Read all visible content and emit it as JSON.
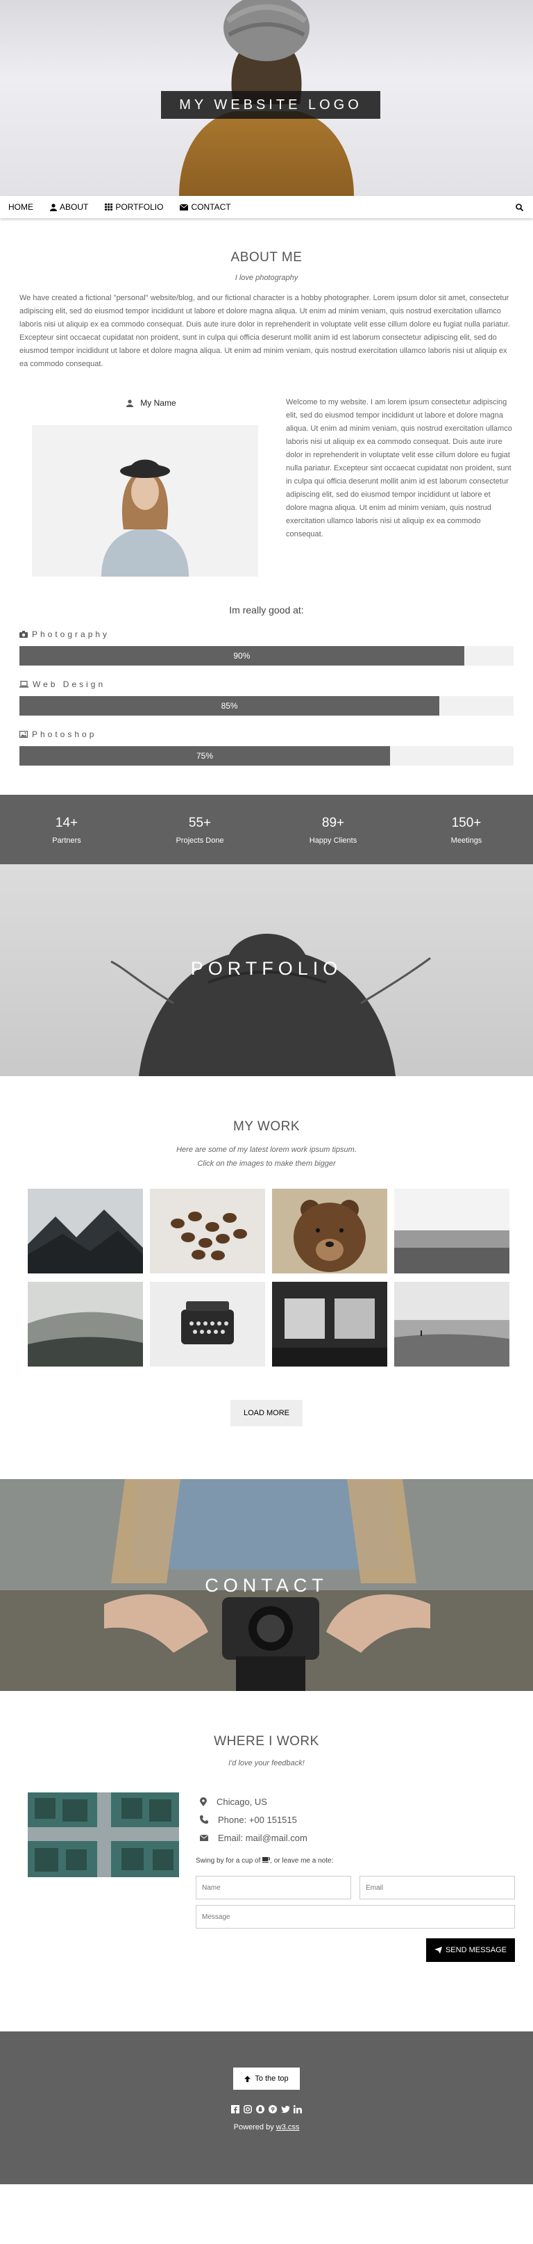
{
  "header": {
    "logo_text": "MY WEBSITE LOGO"
  },
  "nav": {
    "home": "HOME",
    "about": "ABOUT",
    "portfolio": "PORTFOLIO",
    "contact": "CONTACT",
    "search_icon": "search-icon"
  },
  "about": {
    "title": "ABOUT ME",
    "subtitle": "I love photography",
    "intro": "We have created a fictional \"personal\" website/blog, and our fictional character is a hobby photographer. Lorem ipsum dolor sit amet, consectetur adipiscing elit, sed do eiusmod tempor incididunt ut labore et dolore magna aliqua. Ut enim ad minim veniam, quis nostrud exercitation ullamco laboris nisi ut aliquip ex ea commodo consequat. Duis aute irure dolor in reprehenderit in voluptate velit esse cillum dolore eu fugiat nulla pariatur. Excepteur sint occaecat cupidatat non proident, sunt in culpa qui officia deserunt mollit anim id est laborum consectetur adipiscing elit, sed do eiusmod tempor incididunt ut labore et dolore magna aliqua. Ut enim ad minim veniam, quis nostrud exercitation ullamco laboris nisi ut aliquip ex ea commodo consequat.",
    "name": "My Name",
    "welcome": "Welcome to my website. I am lorem ipsum consectetur adipiscing elit, sed do eiusmod tempor incididunt ut labore et dolore magna aliqua. Ut enim ad minim veniam, quis nostrud exercitation ullamco laboris nisi ut aliquip ex ea commodo consequat. Duis aute irure dolor in reprehenderit in voluptate velit esse cillum dolore eu fugiat nulla pariatur. Excepteur sint occaecat cupidatat non proident, sunt in culpa qui officia deserunt mollit anim id est laborum consectetur adipiscing elit, sed do eiusmod tempor incididunt ut labore et dolore magna aliqua. Ut enim ad minim veniam, quis nostrud exercitation ullamco laboris nisi ut aliquip ex ea commodo consequat.",
    "good_at": "Im really good at:",
    "skills": [
      {
        "label": "Photography",
        "percent": 90,
        "percent_text": "90%",
        "icon": "camera-icon"
      },
      {
        "label": "Web Design",
        "percent": 85,
        "percent_text": "85%",
        "icon": "laptop-icon"
      },
      {
        "label": "Photoshop",
        "percent": 75,
        "percent_text": "75%",
        "icon": "image-icon"
      }
    ]
  },
  "stats": [
    {
      "number": "14+",
      "label": "Partners"
    },
    {
      "number": "55+",
      "label": "Projects Done"
    },
    {
      "number": "89+",
      "label": "Happy Clients"
    },
    {
      "number": "150+",
      "label": "Meetings"
    }
  ],
  "portfolio": {
    "banner": "PORTFOLIO"
  },
  "mywork": {
    "title": "MY WORK",
    "line1": "Here are some of my latest lorem work ipsum tipsum.",
    "line2": "Click on the images to make them bigger",
    "load_more": "LOAD MORE"
  },
  "contact": {
    "banner": "CONTACT"
  },
  "where": {
    "title": "WHERE I WORK",
    "subtitle": "I'd love your feedback!",
    "city": "Chicago, US",
    "phone": "Phone: +00 151515",
    "email": "Email: mail@mail.com",
    "swing_before": "Swing by for a cup of",
    "swing_after": ", or leave me a note:",
    "name_placeholder": "Name",
    "email_placeholder": "Email",
    "message_placeholder": "Message",
    "send": "SEND MESSAGE"
  },
  "footer": {
    "to_top": "To the top",
    "powered_prefix": "Powered by",
    "powered_link": "w3.css"
  },
  "colors": {
    "dark_gray": "#616161",
    "light_gray": "#f1f1f1",
    "black": "#000000"
  }
}
